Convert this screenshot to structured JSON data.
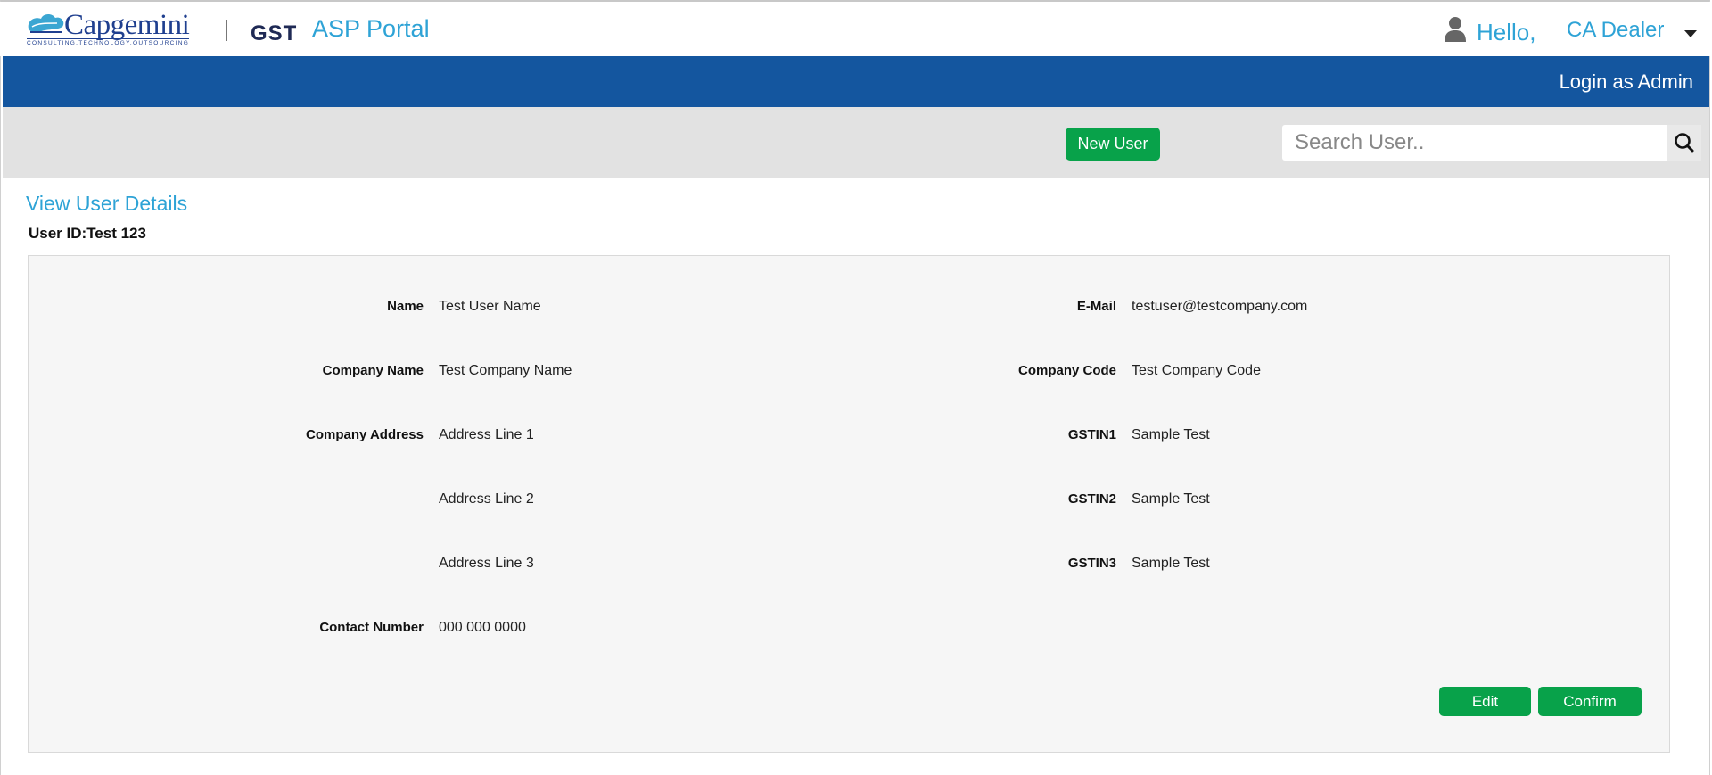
{
  "header": {
    "logo_text": "Capgemini",
    "logo_tagline": "CONSULTING.TECHNOLOGY.OUTSOURCING",
    "product": "GST",
    "portal": "ASP Portal",
    "greeting": "Hello,",
    "user_name": "CA Dealer",
    "user_icon": "person-icon",
    "menu_icon": "caret-down-icon"
  },
  "nav": {
    "login_as": "Login as Admin"
  },
  "toolbar": {
    "new_user_label": "New User",
    "search_placeholder": "Search User..",
    "search_value": "",
    "search_icon": "search-icon"
  },
  "page": {
    "title": "View User Details",
    "user_id_label": "User ID:",
    "user_id_value": "Test 123"
  },
  "details": {
    "left": [
      {
        "label": "Name",
        "value": "Test User Name"
      },
      {
        "label": "Company Name",
        "value": "Test Company Name"
      },
      {
        "label": "Company Address",
        "value": "Address Line 1"
      },
      {
        "label": "",
        "value": "Address Line 2"
      },
      {
        "label": "",
        "value": "Address Line 3"
      },
      {
        "label": "Contact Number",
        "value": "000 000 0000"
      }
    ],
    "right": [
      {
        "label": "E-Mail",
        "value": "testuser@testcompany.com"
      },
      {
        "label": "Company Code",
        "value": "Test Company Code"
      },
      {
        "label": "GSTIN1",
        "value": "Sample Test"
      },
      {
        "label": "GSTIN2",
        "value": "Sample Test"
      },
      {
        "label": "GSTIN3",
        "value": "Sample Test"
      }
    ]
  },
  "actions": {
    "edit_label": "Edit",
    "confirm_label": "Confirm"
  },
  "colors": {
    "brand_blue": "#14569f",
    "accent": "#2ea3d6",
    "button_green": "#08a24a",
    "toolbar_gray": "#e2e2e2",
    "panel_bg": "#f6f6f6"
  }
}
